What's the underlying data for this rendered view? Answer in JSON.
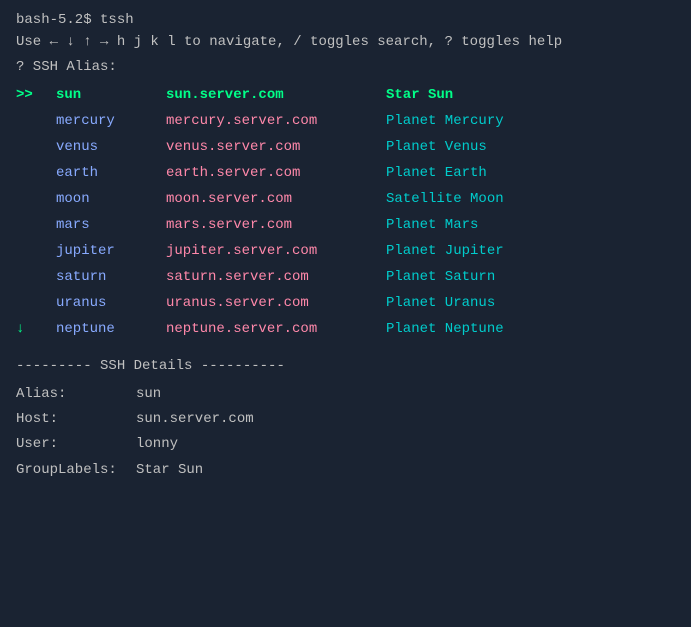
{
  "terminal": {
    "prompt": "bash-5.2$ tssh",
    "nav_hint_line1": "Use ← ↓ ↑ → h j k l to navigate, / toggles search, ? toggles help",
    "nav_hint_line2": "? SSH Alias:",
    "table": {
      "headers": {
        "arrow": ">>",
        "alias": "sun",
        "host": "sun.server.com",
        "label": "Star Sun"
      },
      "rows": [
        {
          "arrow": "",
          "alias": "mercury",
          "host": "mercury.server.com",
          "label": "Planet Mercury",
          "selected": false
        },
        {
          "arrow": "",
          "alias": "venus",
          "host": "venus.server.com",
          "label": "Planet Venus",
          "selected": false
        },
        {
          "arrow": "",
          "alias": "earth",
          "host": "earth.server.com",
          "label": "Planet Earth",
          "selected": false
        },
        {
          "arrow": "",
          "alias": "moon",
          "host": "moon.server.com",
          "label": "Satellite Moon",
          "selected": false
        },
        {
          "arrow": "",
          "alias": "mars",
          "host": "mars.server.com",
          "label": "Planet Mars",
          "selected": false
        },
        {
          "arrow": "",
          "alias": "jupiter",
          "host": "jupiter.server.com",
          "label": "Planet Jupiter",
          "selected": false
        },
        {
          "arrow": "",
          "alias": "saturn",
          "host": "saturn.server.com",
          "label": "Planet Saturn",
          "selected": false
        },
        {
          "arrow": "",
          "alias": "uranus",
          "host": "uranus.server.com",
          "label": "Planet Uranus",
          "selected": false
        },
        {
          "arrow": "↓",
          "alias": "neptune",
          "host": "neptune.server.com",
          "label": "Planet Neptune",
          "selected": false
        }
      ]
    },
    "divider": "--------- SSH Details ----------",
    "details": {
      "alias_label": "Alias:",
      "alias_value": "sun",
      "host_label": "Host:",
      "host_value": "sun.server.com",
      "user_label": "User:",
      "user_value": "lonny",
      "grouplabels_label": "GroupLabels:",
      "grouplabels_value": "Star Sun"
    }
  }
}
